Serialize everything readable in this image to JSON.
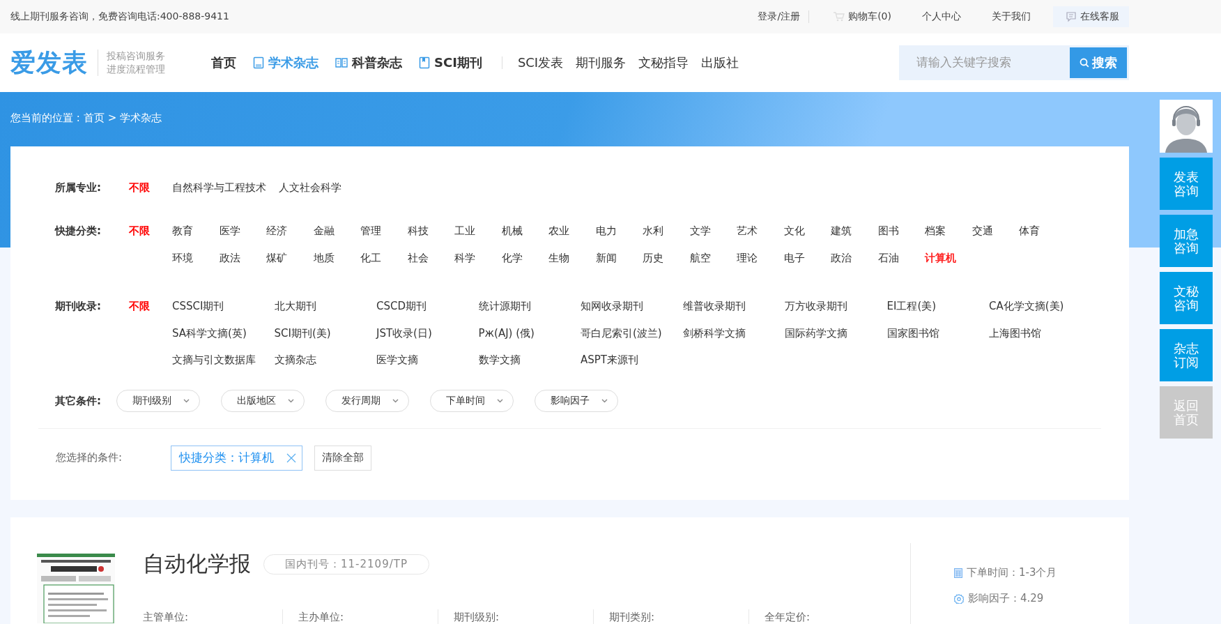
{
  "top_bar": {
    "notice": "线上期刊服务咨询，免费咨询电话:400-888-9411",
    "links": [
      {
        "kind": "login",
        "label": "登录/注册"
      },
      {
        "kind": "cart",
        "label": "购物车(0)"
      },
      {
        "kind": "text",
        "label": "个人中心"
      },
      {
        "kind": "text",
        "label": "关于我们"
      },
      {
        "kind": "service",
        "label": "在线客服"
      }
    ]
  },
  "header": {
    "logo": "爱发表",
    "slogan": [
      "投稿咨询服务",
      "进度流程管理"
    ],
    "nav": [
      {
        "label": "首页",
        "kind": "main",
        "selected": false
      },
      {
        "label": "学术杂志",
        "kind": "main",
        "selected": true
      },
      {
        "label": "科普杂志",
        "kind": "main",
        "selected": false
      },
      {
        "label": "SCI期刊",
        "kind": "main",
        "selected": false
      },
      {
        "label": "SCI发表",
        "kind": "secondary",
        "selected": false
      },
      {
        "label": "期刊服务",
        "kind": "secondary",
        "selected": false
      },
      {
        "label": "文秘指导",
        "kind": "secondary",
        "selected": false
      },
      {
        "label": "出版社",
        "kind": "secondary",
        "selected": false
      }
    ],
    "search": {
      "placeholder": "请输入关键字搜索",
      "button": "搜索"
    }
  },
  "breadcrumb": {
    "label": "您当前的位置 :",
    "items": [
      "首页",
      "学术杂志"
    ],
    "separator": ">"
  },
  "filters": [
    {
      "label": "所属专业:",
      "any": "不限",
      "options": [
        {
          "label": "自然科学与工程技术",
          "selected": false
        },
        {
          "label": "人文社会科学",
          "selected": false
        }
      ]
    },
    {
      "label": "快捷分类:",
      "any": "不限",
      "options": [
        {
          "label": "教育",
          "selected": false
        },
        {
          "label": "医学",
          "selected": false
        },
        {
          "label": "经济",
          "selected": false
        },
        {
          "label": "金融",
          "selected": false
        },
        {
          "label": "管理",
          "selected": false
        },
        {
          "label": "科技",
          "selected": false
        },
        {
          "label": "工业",
          "selected": false
        },
        {
          "label": "机械",
          "selected": false
        },
        {
          "label": "农业",
          "selected": false
        },
        {
          "label": "电力",
          "selected": false
        },
        {
          "label": "水利",
          "selected": false
        },
        {
          "label": "文学",
          "selected": false
        },
        {
          "label": "艺术",
          "selected": false
        },
        {
          "label": "文化",
          "selected": false
        },
        {
          "label": "建筑",
          "selected": false
        },
        {
          "label": "图书",
          "selected": false
        },
        {
          "label": "档案",
          "selected": false
        },
        {
          "label": "交通",
          "selected": false
        },
        {
          "label": "体育",
          "selected": false
        },
        {
          "label": "环境",
          "selected": false
        },
        {
          "label": "政法",
          "selected": false
        },
        {
          "label": "煤矿",
          "selected": false
        },
        {
          "label": "地质",
          "selected": false
        },
        {
          "label": "化工",
          "selected": false
        },
        {
          "label": "社会",
          "selected": false
        },
        {
          "label": "科学",
          "selected": false
        },
        {
          "label": "化学",
          "selected": false
        },
        {
          "label": "生物",
          "selected": false
        },
        {
          "label": "新闻",
          "selected": false
        },
        {
          "label": "历史",
          "selected": false
        },
        {
          "label": "航空",
          "selected": false
        },
        {
          "label": "理论",
          "selected": false
        },
        {
          "label": "电子",
          "selected": false
        },
        {
          "label": "政治",
          "selected": false
        },
        {
          "label": "石油",
          "selected": false
        },
        {
          "label": "计算机",
          "selected": true
        }
      ]
    },
    {
      "label": "期刊收录:",
      "any": "不限",
      "options": [
        {
          "label": "CSSCI期刊",
          "selected": false
        },
        {
          "label": "北大期刊",
          "selected": false
        },
        {
          "label": "CSCD期刊",
          "selected": false
        },
        {
          "label": "统计源期刊",
          "selected": false
        },
        {
          "label": "知网收录期刊",
          "selected": false
        },
        {
          "label": "维普收录期刊",
          "selected": false
        },
        {
          "label": "万方收录期刊",
          "selected": false
        },
        {
          "label": "EI工程(美)",
          "selected": false
        },
        {
          "label": "CA化学文摘(美)",
          "selected": false
        },
        {
          "label": "SA科学文摘(英)",
          "selected": false
        },
        {
          "label": "SCI期刊(美)",
          "selected": false
        },
        {
          "label": "JST收录(日)",
          "selected": false
        },
        {
          "label": "Рж(AJ) (俄)",
          "selected": false
        },
        {
          "label": "哥白尼索引(波兰)",
          "selected": false
        },
        {
          "label": "剑桥科学文摘",
          "selected": false
        },
        {
          "label": "国际药学文摘",
          "selected": false
        },
        {
          "label": "国家图书馆",
          "selected": false
        },
        {
          "label": "上海图书馆",
          "selected": false
        },
        {
          "label": "文摘与引文数据库",
          "selected": false
        },
        {
          "label": "文摘杂志",
          "selected": false
        },
        {
          "label": "医学文摘",
          "selected": false
        },
        {
          "label": "数学文摘",
          "selected": false
        },
        {
          "label": "ASPT来源刊",
          "selected": false
        }
      ]
    }
  ],
  "other_conditions": {
    "label": "其它条件:",
    "dropdowns": [
      "期刊级别",
      "出版地区",
      "发行周期",
      "下单时间",
      "影响因子"
    ]
  },
  "selected_conditions": {
    "label": "您选择的条件:",
    "chips": [
      "快捷分类：计算机"
    ],
    "clear_button": "清除全部"
  },
  "journal": {
    "kind": "picture",
    "title": "自动化学报",
    "issn": "国内刊号：11-2109/TP",
    "fields": [
      "主管单位:",
      "主办单位:",
      "期刊级别:",
      "期刊类别:",
      "全年定价:"
    ],
    "info": [
      {
        "kind": "calendar",
        "text": "下单时间：1-3个月"
      },
      {
        "kind": "gear",
        "text": "影响因子：4.29"
      }
    ]
  },
  "sidebar": {
    "buttons": [
      {
        "label": "发表咨询",
        "kind": "primary"
      },
      {
        "label": "加急咨询",
        "kind": "primary"
      },
      {
        "label": "文秘咨询",
        "kind": "primary"
      },
      {
        "label": "杂志订阅",
        "kind": "primary"
      },
      {
        "label": "返回首页",
        "kind": "muted"
      }
    ]
  }
}
